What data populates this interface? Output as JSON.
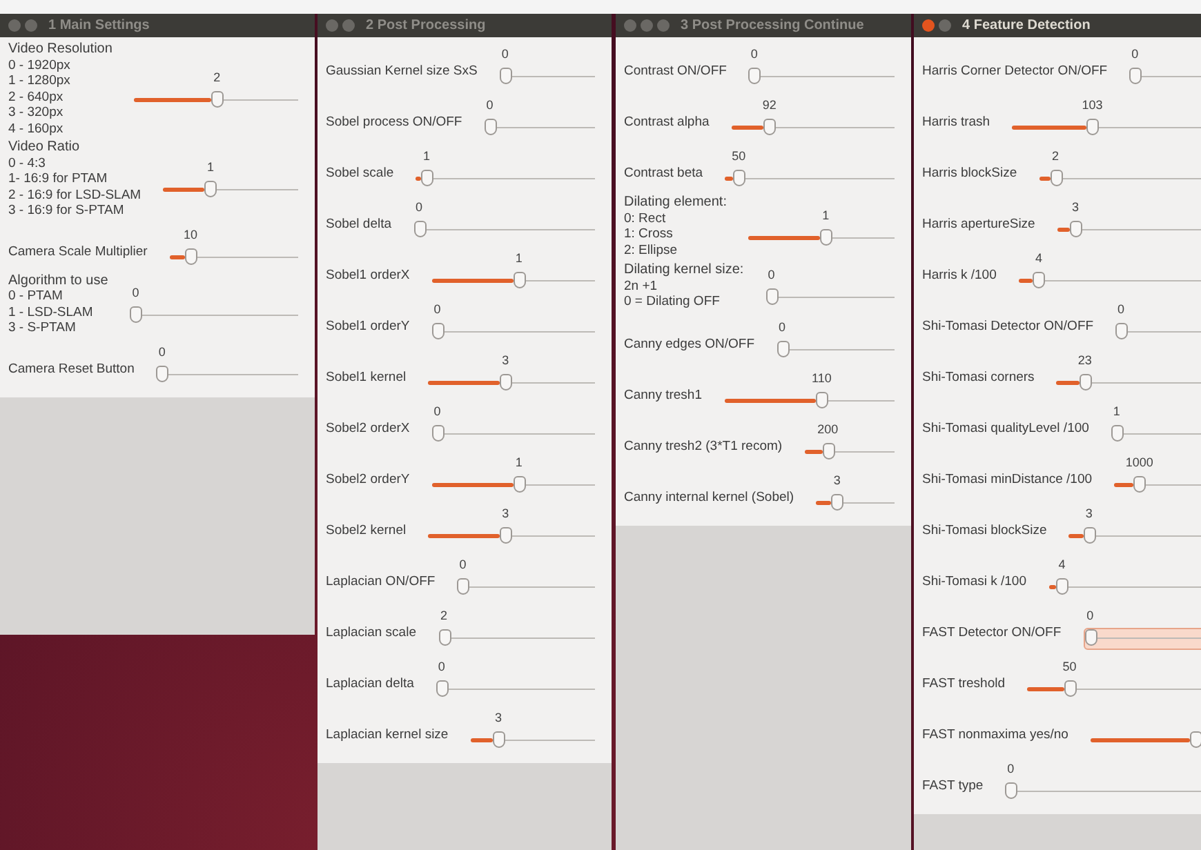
{
  "windows": [
    {
      "title": "1 Main Settings",
      "focused": false,
      "buttons": [
        {
          "kind": "close"
        },
        {
          "kind": "minimize"
        }
      ],
      "trackbars": [
        {
          "lines": [
            "Video Resolution",
            "0 - 1920px",
            "1 - 1280px",
            "2 - 640px",
            "3 - 320px",
            "4 - 160px"
          ],
          "value": "2",
          "level": 0.47
        },
        {
          "lines": [
            "Video Ratio",
            "0 - 4:3",
            "1- 16:9 for PTAM",
            "2 - 16:9 for LSD-SLAM",
            "3 - 16:9 for S-PTAM"
          ],
          "value": "1",
          "level": 0.31
        },
        {
          "lines": [
            "Camera Scale Multiplier"
          ],
          "value": "10",
          "level": 0.12
        },
        {
          "lines": [
            "Algorithm to use",
            "0 - PTAM",
            "1 - LSD-SLAM",
            "3 - S-PTAM"
          ],
          "value": "0",
          "level": 0
        },
        {
          "lines": [
            "Camera Reset Button"
          ],
          "value": "0",
          "level": 0
        }
      ]
    },
    {
      "title": "2 Post Processing",
      "focused": false,
      "buttons": [
        {
          "kind": "close"
        },
        {
          "kind": "minimize"
        }
      ],
      "trackbars": [
        {
          "lines": [
            "Gaussian Kernel size SxS"
          ],
          "value": "0",
          "level": 0
        },
        {
          "lines": [
            "Sobel process ON/OFF"
          ],
          "value": "0",
          "level": 0
        },
        {
          "lines": [
            "Sobel scale"
          ],
          "value": "1",
          "level": 0.03
        },
        {
          "lines": [
            "Sobel delta"
          ],
          "value": "0",
          "level": 0
        },
        {
          "lines": [
            "Sobel1 orderX"
          ],
          "value": "1",
          "level": 0.5
        },
        {
          "lines": [
            "Sobel1 orderY"
          ],
          "value": "0",
          "level": 0
        },
        {
          "lines": [
            "Sobel1 kernel"
          ],
          "value": "3",
          "level": 0.43
        },
        {
          "lines": [
            "Sobel2 orderX"
          ],
          "value": "0",
          "level": 0
        },
        {
          "lines": [
            "Sobel2 orderY"
          ],
          "value": "1",
          "level": 0.5
        },
        {
          "lines": [
            "Sobel2 kernel"
          ],
          "value": "3",
          "level": 0.43
        },
        {
          "lines": [
            "Laplacian ON/OFF"
          ],
          "value": "0",
          "level": 0
        },
        {
          "lines": [
            "Laplacian scale"
          ],
          "value": "2",
          "level": 0
        },
        {
          "lines": [
            "Laplacian delta"
          ],
          "value": "0",
          "level": 0
        },
        {
          "lines": [
            "Laplacian kernel size"
          ],
          "value": "3",
          "level": 0.18
        }
      ]
    },
    {
      "title": "3 Post Processing Continue",
      "focused": false,
      "buttons": [
        {
          "kind": "close"
        },
        {
          "kind": "minimize"
        },
        {
          "kind": "maximize"
        }
      ],
      "trackbars": [
        {
          "lines": [
            "Contrast ON/OFF"
          ],
          "value": "0",
          "level": 0
        },
        {
          "lines": [
            "Contrast alpha"
          ],
          "value": "92",
          "level": 0.2
        },
        {
          "lines": [
            "Contrast beta"
          ],
          "value": "50",
          "level": 0.05
        },
        {
          "lines": [
            "Dilating element:",
            "0: Rect",
            "1: Cross",
            "2: Ellipse"
          ],
          "value": "1",
          "level": 0.49
        },
        {
          "lines": [
            "Dilating kernel size:",
            "2n +1",
            "0 = Dilating OFF"
          ],
          "value": "0",
          "level": 0
        },
        {
          "lines": [
            "Canny edges ON/OFF"
          ],
          "value": "0",
          "level": 0
        },
        {
          "lines": [
            "Canny tresh1"
          ],
          "value": "110",
          "level": 0.54
        },
        {
          "lines": [
            "Canny tresh2 (3*T1 recom)"
          ],
          "value": "200",
          "level": 0.2
        },
        {
          "lines": [
            "Canny internal kernel (Sobel)"
          ],
          "value": "3",
          "level": 0.2
        }
      ]
    },
    {
      "title": "4 Feature Detection",
      "focused": true,
      "buttons": [
        {
          "kind": "close"
        },
        {
          "kind": "minimize"
        }
      ],
      "trackbars": [
        {
          "lines": [
            "Harris Corner Detector ON/OFF"
          ],
          "value": "0",
          "level": 0,
          "hovered": false
        },
        {
          "lines": [
            "Harris trash"
          ],
          "value": "103",
          "level": 0.25,
          "hovered": false
        },
        {
          "lines": [
            "Harris blockSize"
          ],
          "value": "2",
          "level": 0.04,
          "hovered": false
        },
        {
          "lines": [
            "Harris apertureSize"
          ],
          "value": "3",
          "level": 0.05,
          "hovered": false
        },
        {
          "lines": [
            "Harris k /100"
          ],
          "value": "4",
          "level": 0.05,
          "hovered": false
        },
        {
          "lines": [
            "Shi-Tomasi Detector ON/OFF"
          ],
          "value": "0",
          "level": 0,
          "hovered": false
        },
        {
          "lines": [
            "Shi-Tomasi corners"
          ],
          "value": "23",
          "level": 0.09,
          "hovered": false
        },
        {
          "lines": [
            "Shi-Tomasi qualityLevel /100"
          ],
          "value": "1",
          "level": 0,
          "hovered": false
        },
        {
          "lines": [
            "Shi-Tomasi minDistance /100"
          ],
          "value": "1000",
          "level": 0.1,
          "hovered": false
        },
        {
          "lines": [
            "Shi-Tomasi blockSize"
          ],
          "value": "3",
          "level": 0.06,
          "hovered": false
        },
        {
          "lines": [
            "Shi-Tomasi k /100"
          ],
          "value": "4",
          "level": 0.03,
          "hovered": false
        },
        {
          "lines": [
            "FAST Detector ON/OFF"
          ],
          "value": "0",
          "level": 0,
          "hovered": true
        },
        {
          "lines": [
            "FAST treshold"
          ],
          "value": "50",
          "level": 0.13,
          "hovered": false
        },
        {
          "lines": [
            "FAST nonmaxima yes/no"
          ],
          "level": 0.45,
          "hovered": false
        },
        {
          "lines": [
            "FAST type"
          ],
          "value": "0",
          "level": 0,
          "hovered": false
        }
      ]
    }
  ]
}
